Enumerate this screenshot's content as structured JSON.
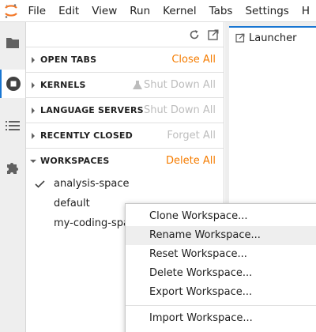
{
  "menubar": {
    "items": [
      "File",
      "Edit",
      "View",
      "Run",
      "Kernel",
      "Tabs",
      "Settings",
      "H"
    ]
  },
  "sidebar": {
    "sections": [
      {
        "title": "OPEN TABS",
        "action": "Close All",
        "enabled": true
      },
      {
        "title": "KERNELS",
        "action": "Shut Down All",
        "enabled": false
      },
      {
        "title": "LANGUAGE SERVERS",
        "action": "Shut Down All",
        "enabled": false
      },
      {
        "title": "RECENTLY CLOSED",
        "action": "Forget All",
        "enabled": false
      },
      {
        "title": "WORKSPACES",
        "action": "Delete All",
        "enabled": true
      }
    ],
    "workspaces": [
      {
        "name": "analysis-space",
        "current": true
      },
      {
        "name": "default",
        "current": false
      },
      {
        "name": "my-coding-space",
        "current": false
      }
    ]
  },
  "main": {
    "tab_label": "Launcher"
  },
  "context_menu": {
    "items": [
      "Clone Workspace...",
      "Rename Workspace...",
      "Reset Workspace...",
      "Delete Workspace...",
      "Export Workspace...",
      "Import Workspace..."
    ],
    "hovered": "Rename Workspace..."
  },
  "colors": {
    "accent": "#f57c00",
    "disabled": "#bdbdbd",
    "active_tab_border": "#1976d2"
  },
  "icons": {
    "logo": "jupyter-logo-icon",
    "refresh": "refresh-icon",
    "open_new": "open-new-window-icon",
    "kernel_shutdown": "shutdown-icon",
    "check": "check-icon"
  }
}
